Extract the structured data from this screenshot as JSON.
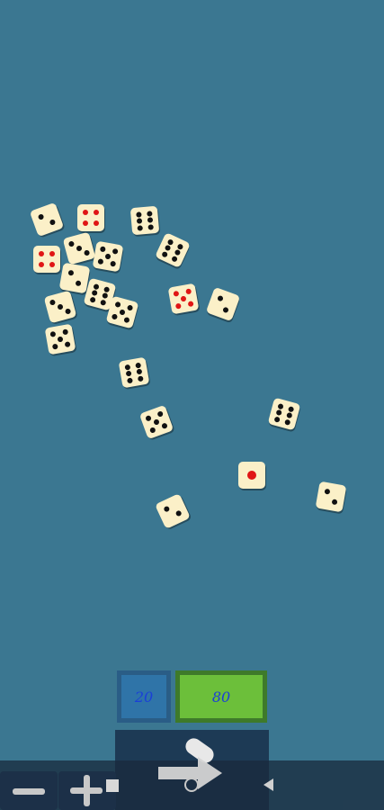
{
  "game": {
    "dice": [
      {
        "value": 2,
        "pip_color": "black"
      },
      {
        "value": 4,
        "pip_color": "red"
      },
      {
        "value": 6,
        "pip_color": "black"
      },
      {
        "value": 4,
        "pip_color": "red"
      },
      {
        "value": 3,
        "pip_color": "black"
      },
      {
        "value": 5,
        "pip_color": "black"
      },
      {
        "value": 2,
        "pip_color": "black"
      },
      {
        "value": 6,
        "pip_color": "black"
      },
      {
        "value": 6,
        "pip_color": "black"
      },
      {
        "value": 5,
        "pip_color": "red"
      },
      {
        "value": 3,
        "pip_color": "black"
      },
      {
        "value": 5,
        "pip_color": "black"
      },
      {
        "value": 2,
        "pip_color": "black"
      },
      {
        "value": 5,
        "pip_color": "black"
      },
      {
        "value": 6,
        "pip_color": "black"
      },
      {
        "value": 5,
        "pip_color": "black"
      },
      {
        "value": 6,
        "pip_color": "black"
      },
      {
        "value": 1,
        "pip_color": "red"
      },
      {
        "value": 2,
        "pip_color": "black"
      },
      {
        "value": 2,
        "pip_color": "black"
      }
    ]
  },
  "scores": {
    "left": "20",
    "right": "80"
  },
  "controls": {
    "minus_icon": "minus-icon",
    "plus_icon": "plus-icon",
    "roll_icon": "roll-arrow-icon",
    "home_icon": "home-circle-icon",
    "back_icon": "back-triangle-icon"
  },
  "colors": {
    "table": "#3b7791",
    "die_face": "#fbf0c8",
    "pip_black": "#111111",
    "pip_red": "#e01515",
    "score_left_bg": "#2f74a8",
    "score_right_bg": "#6cbf3a",
    "score_text": "#1a3fd8"
  }
}
